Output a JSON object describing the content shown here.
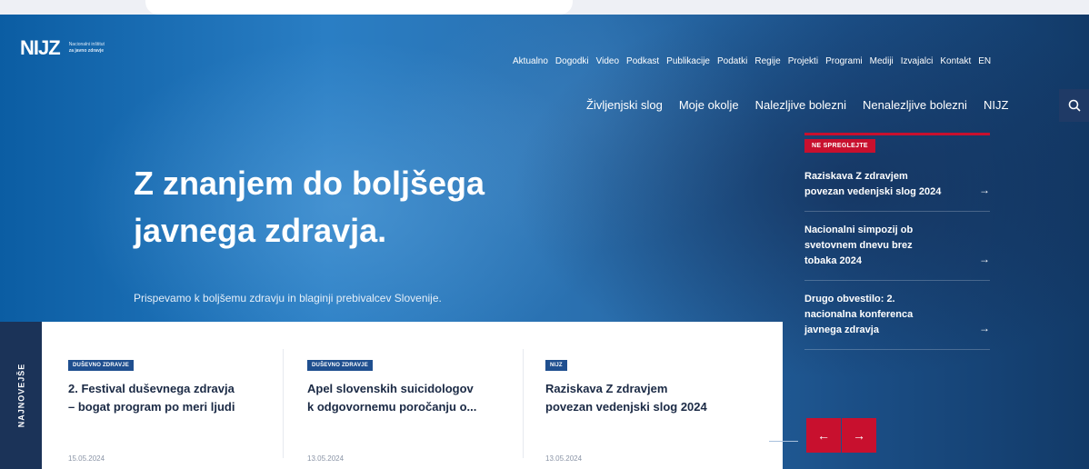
{
  "logo": {
    "mark": "NIJZ",
    "sub_line1": "Nacionalni inštitut",
    "sub_line2": "za javno zdravje"
  },
  "topnav": [
    "Aktualno",
    "Dogodki",
    "Video",
    "Podkast",
    "Publikacije",
    "Podatki",
    "Regije",
    "Projekti",
    "Programi",
    "Mediji",
    "Izvajalci",
    "Kontakt",
    "EN"
  ],
  "mainnav": [
    "Življenjski slog",
    "Moje okolje",
    "Nalezljive bolezni",
    "Nenalezljive bolezni",
    "NIJZ"
  ],
  "search_icon": "search-icon",
  "hero": {
    "headline_line1": "Z znanjem do boljšega",
    "headline_line2": "javnega zdravja.",
    "subline": "Prispevamo k boljšemu zdravju in blaginji prebivalcev Slovenije."
  },
  "ne_spreglejte": {
    "badge": "NE SPREGLEJTE",
    "items": [
      {
        "l1": "Raziskava Z zdravjem",
        "l2": "povezan vedenjski slog 2024",
        "l3": ""
      },
      {
        "l1": "Nacionalni simpozij ob",
        "l2": "svetovnem dnevu brez",
        "l3": "tobaka 2024"
      },
      {
        "l1": "Drugo obvestilo: 2.",
        "l2": "nacionalna konferenca",
        "l3": "javnega zdravja"
      }
    ],
    "arrow": "→"
  },
  "news": {
    "side_label": "NAJNOVEJŠE",
    "cards": [
      {
        "tag": "DUŠEVNO ZDRAVJE",
        "l1": "2. Festival duševnega zdravja",
        "l2": "– bogat program po meri ljudi",
        "date": "15.05.2024"
      },
      {
        "tag": "DUŠEVNO ZDRAVJE",
        "l1": "Apel slovenskih suicidologov",
        "l2": "k odgovornemu poročanju o...",
        "date": "13.05.2024"
      },
      {
        "tag": "NIJZ",
        "l1": "Raziskava Z zdravjem",
        "l2": "povezan vedenjski slog 2024",
        "date": "13.05.2024"
      }
    ]
  },
  "slider": {
    "prev": "←",
    "next": "→"
  },
  "colors": {
    "accent": "#c8102e",
    "navy": "#1b3358",
    "tag_blue": "#1f4f8f"
  }
}
